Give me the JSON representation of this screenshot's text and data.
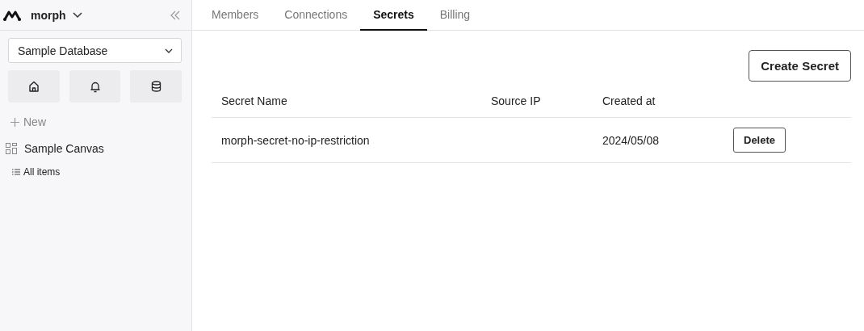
{
  "sidebar": {
    "workspace": "morph",
    "database": "Sample Database",
    "new_label": "New",
    "items": [
      {
        "label": "Sample Canvas",
        "kind": "canvas"
      },
      {
        "label": "All items",
        "kind": "list"
      }
    ]
  },
  "tabs": [
    {
      "label": "Members",
      "selected": false
    },
    {
      "label": "Connections",
      "selected": false
    },
    {
      "label": "Secrets",
      "selected": true
    },
    {
      "label": "Billing",
      "selected": false
    }
  ],
  "create_button": "Create Secret",
  "table": {
    "columns": [
      "Secret Name",
      "Source IP",
      "Created at"
    ],
    "rows": [
      {
        "name": "morph-secret-no-ip-restriction",
        "created_at": "2024/05/08",
        "action": "Delete"
      }
    ]
  }
}
